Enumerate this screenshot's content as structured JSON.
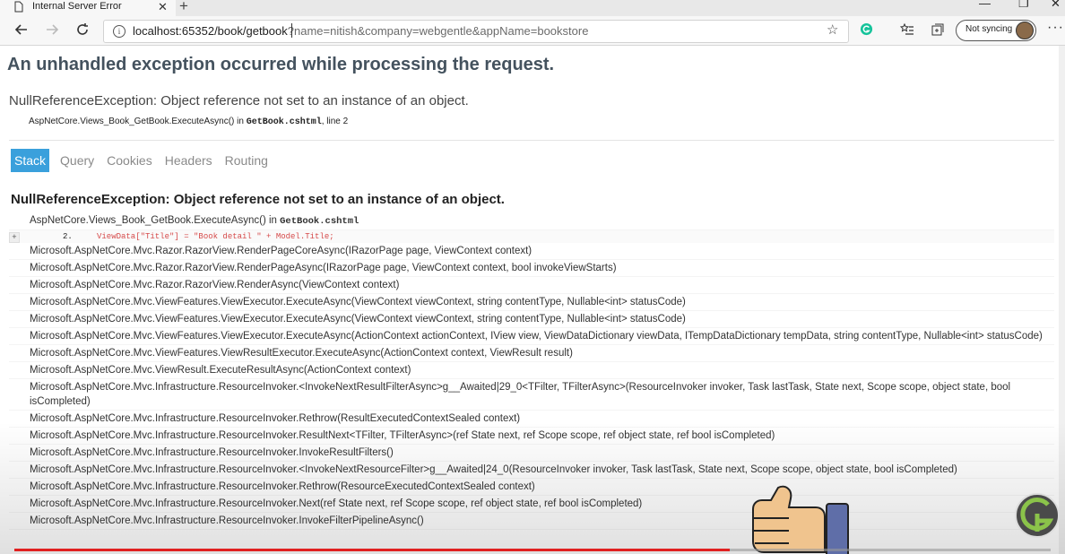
{
  "browser": {
    "tab_title": "Internal Server Error",
    "url_host": "localhost:65352/book/getbook",
    "url_query": "?name=nitish&company=webgentle&appName=bookstore",
    "sync_label": "Not syncing",
    "new_tab": "+",
    "tab_close": "✕",
    "win_minimize": "—",
    "win_restore": "❐",
    "win_close": "✕",
    "more": "···"
  },
  "error": {
    "heading": "An unhandled exception occurred while processing the request.",
    "message": "NullReferenceException: Object reference not set to an instance of an object.",
    "location_prefix": "AspNetCore.Views_Book_GetBook.ExecuteAsync() in",
    "location_file": "GetBook.cshtml",
    "location_line": ", line 2"
  },
  "tabs": [
    "Stack",
    "Query",
    "Cookies",
    "Headers",
    "Routing"
  ],
  "stack": {
    "heading": "NullReferenceException: Object reference not set to an instance of an object.",
    "first_frame": "AspNetCore.Views_Book_GetBook.ExecuteAsync() in ",
    "first_file": "GetBook.cshtml",
    "code_expand": "+",
    "code_line_no": "2.",
    "code": "ViewData[\"Title\"] = \"Book detail \" + Model.Title;",
    "frames": [
      "Microsoft.AspNetCore.Mvc.Razor.RazorView.RenderPageCoreAsync(IRazorPage page, ViewContext context)",
      "Microsoft.AspNetCore.Mvc.Razor.RazorView.RenderPageAsync(IRazorPage page, ViewContext context, bool invokeViewStarts)",
      "Microsoft.AspNetCore.Mvc.Razor.RazorView.RenderAsync(ViewContext context)",
      "Microsoft.AspNetCore.Mvc.ViewFeatures.ViewExecutor.ExecuteAsync(ViewContext viewContext, string contentType, Nullable<int> statusCode)",
      "Microsoft.AspNetCore.Mvc.ViewFeatures.ViewExecutor.ExecuteAsync(ViewContext viewContext, string contentType, Nullable<int> statusCode)",
      "Microsoft.AspNetCore.Mvc.ViewFeatures.ViewExecutor.ExecuteAsync(ActionContext actionContext, IView view, ViewDataDictionary viewData, ITempDataDictionary tempData, string contentType, Nullable<int> statusCode)",
      "Microsoft.AspNetCore.Mvc.ViewFeatures.ViewResultExecutor.ExecuteAsync(ActionContext context, ViewResult result)",
      "Microsoft.AspNetCore.Mvc.ViewResult.ExecuteResultAsync(ActionContext context)",
      "Microsoft.AspNetCore.Mvc.Infrastructure.ResourceInvoker.<InvokeNextResultFilterAsync>g__Awaited|29_0<TFilter, TFilterAsync>(ResourceInvoker invoker, Task lastTask, State next, Scope scope, object state, bool isCompleted)",
      "Microsoft.AspNetCore.Mvc.Infrastructure.ResourceInvoker.Rethrow(ResultExecutedContextSealed context)",
      "Microsoft.AspNetCore.Mvc.Infrastructure.ResourceInvoker.ResultNext<TFilter, TFilterAsync>(ref State next, ref Scope scope, ref object state, ref bool isCompleted)",
      "Microsoft.AspNetCore.Mvc.Infrastructure.ResourceInvoker.InvokeResultFilters()",
      "Microsoft.AspNetCore.Mvc.Infrastructure.ResourceInvoker.<InvokeNextResourceFilter>g__Awaited|24_0(ResourceInvoker invoker, Task lastTask, State next, Scope scope, object state, bool isCompleted)",
      "Microsoft.AspNetCore.Mvc.Infrastructure.ResourceInvoker.Rethrow(ResourceExecutedContextSealed context)",
      "Microsoft.AspNetCore.Mvc.Infrastructure.ResourceInvoker.Next(ref State next, ref Scope scope, ref object state, ref bool isCompleted)",
      "Microsoft.AspNetCore.Mvc.Infrastructure.ResourceInvoker.InvokeFilterPipelineAsync()"
    ]
  },
  "video": {
    "progress": 0.69
  },
  "colors": {
    "active_tab": "#3aa0dc",
    "heading": "#44525e",
    "code": "#d64b4b",
    "progress": "#e02020"
  },
  "icons": [
    "page-icon",
    "back-icon",
    "forward-icon",
    "refresh-icon",
    "info-icon",
    "star-icon",
    "grammarly-icon",
    "favorites-icon",
    "collections-icon",
    "thumbs-up-icon",
    "channel-logo-icon"
  ]
}
